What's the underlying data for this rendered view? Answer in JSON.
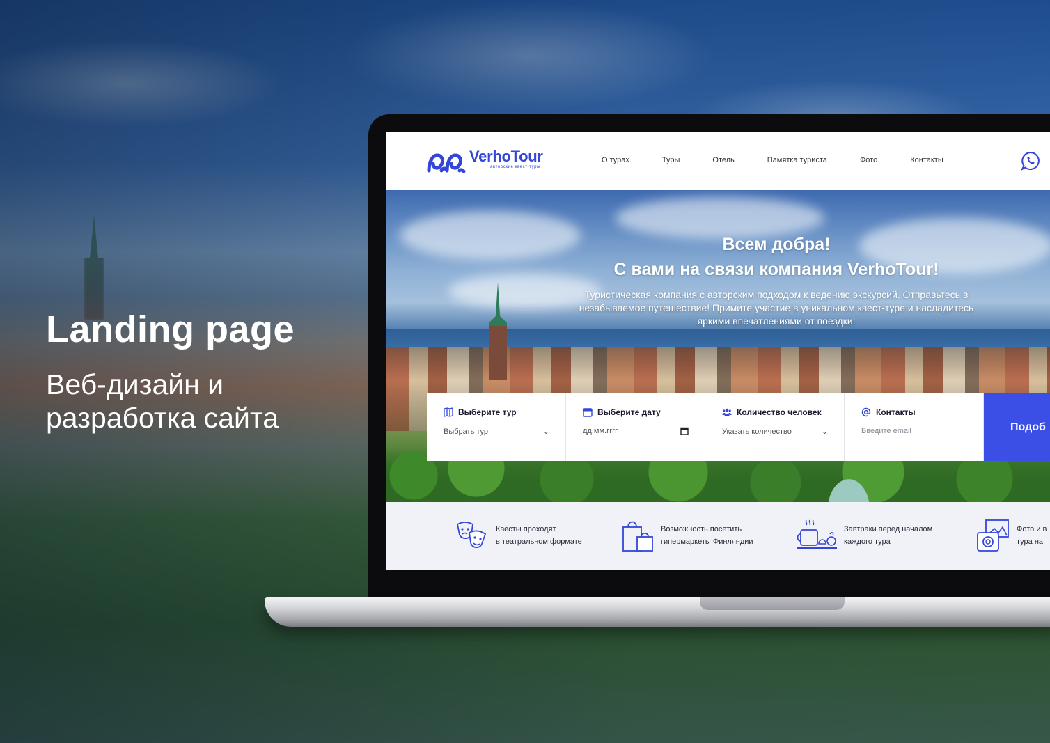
{
  "promo": {
    "title": "Landing page",
    "subtitle": "Веб-дизайн и разработка сайта"
  },
  "site": {
    "logo": {
      "name": "VerhoTour",
      "tagline": "авторские квест-туры"
    },
    "nav": [
      "О турах",
      "Туры",
      "Отель",
      "Памятка туриста",
      "Фото",
      "Контакты"
    ],
    "header_icon": "whatsapp-icon",
    "hero": {
      "heading_line1": "Всем добра!",
      "heading_line2": "С вами на связи компания VerhoTour!",
      "text": "Туристическая компания с авторским подходом к ведению экскурсий. Отправьтесь в незабываемое путешествие! Примите участие в уникальном квест-туре и насладитесь яркими впечатлениями от поездки!"
    },
    "booking": {
      "tour": {
        "label": "Выберите тур",
        "value": "Выбрать тур",
        "icon": "map-icon"
      },
      "date": {
        "label": "Выберите дату",
        "placeholder": "дд.мм.гггг",
        "icon": "calendar-icon"
      },
      "people": {
        "label": "Количество человек",
        "value": "Указать количество",
        "icon": "people-icon"
      },
      "contacts": {
        "label": "Контакты",
        "placeholder": "Введите email",
        "icon": "at-icon"
      },
      "submit": "Подоб"
    },
    "features": [
      {
        "line1": "Квесты проходят",
        "line2": "в театральном формате",
        "icon": "theater-masks-icon"
      },
      {
        "line1": "Возможность посетить",
        "line2": "гипермаркеты Финляндии",
        "icon": "shopping-bags-icon"
      },
      {
        "line1": "Завтраки перед началом",
        "line2": "каждого тура",
        "icon": "breakfast-icon"
      },
      {
        "line1": "Фото и в",
        "line2": "тура на",
        "icon": "camera-photo-icon"
      }
    ]
  },
  "colors": {
    "accent": "#3b4fe6",
    "brand": "#3346d8",
    "feature_bg": "#f1f2f8"
  }
}
